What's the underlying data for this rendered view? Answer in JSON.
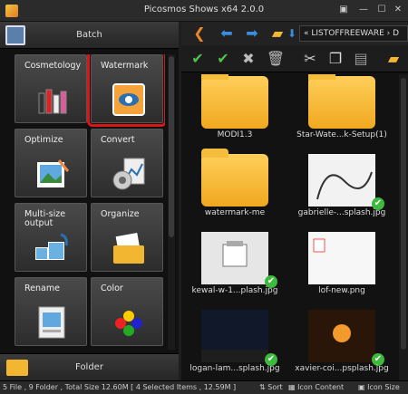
{
  "window": {
    "title": "Picosmos Shows x64 2.0.0",
    "icons": [
      "app-icon",
      "monitor-icon",
      "minimize-icon",
      "maximize-icon",
      "close-icon"
    ]
  },
  "left_panel": {
    "batch_label": "Batch",
    "folder_label": "Folder",
    "tiles": [
      {
        "label": "Cosmetology",
        "icon": "lipstick-icon",
        "selected": false
      },
      {
        "label": "Watermark",
        "icon": "watermark-icon",
        "selected": true
      },
      {
        "label": "Optimize",
        "icon": "optimize-icon",
        "selected": false
      },
      {
        "label": "Convert",
        "icon": "convert-icon",
        "selected": false
      },
      {
        "label": "Multi-size\noutput",
        "icon": "multisize-icon",
        "selected": false
      },
      {
        "label": "Organize",
        "icon": "organize-icon",
        "selected": false
      },
      {
        "label": "Rename",
        "icon": "rename-icon",
        "selected": false
      },
      {
        "label": "Color",
        "icon": "color-icon",
        "selected": false
      }
    ]
  },
  "right_panel": {
    "address": "« LISTOFFREEWARE › D",
    "nav_icons": [
      "back-arrow-icon",
      "left-arrow-icon",
      "right-arrow-icon",
      "folder-up-icon",
      "down-arrow-icon"
    ],
    "tool_icons": [
      "check-icon",
      "check-icon",
      "tools-icon",
      "delete-icon",
      "cut-icon",
      "copy-icon",
      "paste-icon",
      "folder-icon"
    ],
    "files": [
      {
        "name": "MODI1.3",
        "kind": "folder",
        "checked": false
      },
      {
        "name": "Star-Wate...k-Setup(1)",
        "kind": "folder",
        "checked": false
      },
      {
        "name": "watermark-me",
        "kind": "folder",
        "checked": false
      },
      {
        "name": "gabrielle-...splash.jpg",
        "kind": "image",
        "checked": true
      },
      {
        "name": "kewal-w-1...plash.jpg",
        "kind": "image",
        "checked": true
      },
      {
        "name": "lof-new.png",
        "kind": "image",
        "checked": false
      },
      {
        "name": "logan-lam...splash.jpg",
        "kind": "image",
        "checked": true
      },
      {
        "name": "xavier-coi...psplash.jpg",
        "kind": "image",
        "checked": true
      }
    ]
  },
  "status": {
    "summary": "5 File , 9 Folder , Total Size 12.60M [ 4 Selected Items , 12.59M ]",
    "sort_label": "Sort",
    "icon_content_label": "Icon Content",
    "icon_size_label": "Icon Size"
  },
  "colors": {
    "selection_outline": "#d81818",
    "folder": "#f2b630",
    "check": "#3db93d"
  }
}
